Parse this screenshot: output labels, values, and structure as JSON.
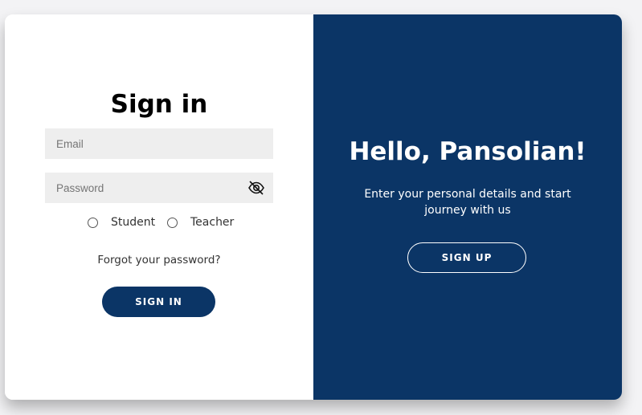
{
  "signin": {
    "title": "Sign in",
    "email_placeholder": "Email",
    "password_placeholder": "Password",
    "password_visibility_icon": "eye-slash-icon",
    "roles": [
      {
        "label": "Student",
        "selected": false
      },
      {
        "label": "Teacher",
        "selected": false
      }
    ],
    "forgot_link": "Forgot your password?",
    "button_label": "SIGN IN"
  },
  "welcome": {
    "title": "Hello, Pansolian!",
    "subtitle": "Enter your personal details and start journey with us",
    "button_label": "SIGN UP"
  },
  "colors": {
    "brand_navy": "#0b3566",
    "input_bg": "#eeeeee",
    "page_bg": "#f3f3f5"
  }
}
